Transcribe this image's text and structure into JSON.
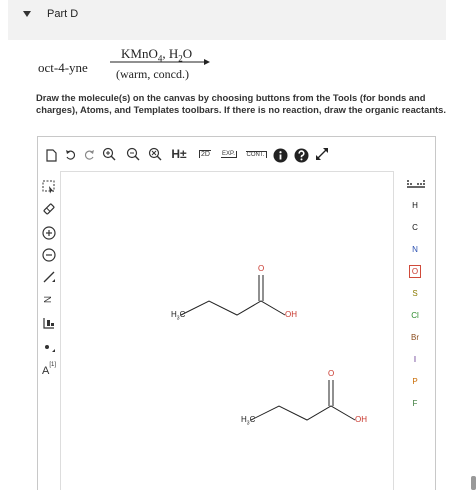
{
  "part": {
    "title": "Part D"
  },
  "reaction": {
    "reactant": "oct-4-yne",
    "reagent_main": "KMnO",
    "reagent_sub1": "4",
    "reagent_sep": ", H",
    "reagent_sub2": "2",
    "reagent_end": "O",
    "conditions": "(warm, concd.)"
  },
  "instructions": "Draw the molecule(s) on the canvas by choosing buttons from the Tools (for bonds and charges), Atoms, and Templates toolbars. If there is no reaction, draw the organic reactants.",
  "toolbar": {
    "h_label": "H±",
    "two_d_label": "2D",
    "exp_label": "EXP.",
    "cont_label": "CONT."
  },
  "left_tools": {
    "n_label": "N",
    "charge_label": "A",
    "charge_sup": "[1]"
  },
  "atoms": [
    "H",
    "C",
    "N",
    "O",
    "S",
    "Cl",
    "Br",
    "I",
    "P",
    "F"
  ],
  "molecules": [
    {
      "left_label": "H",
      "left_sub": "3",
      "left_end": "C",
      "carbonyl": "O",
      "hydroxyl": "OH"
    },
    {
      "left_label": "H",
      "left_sub": "3",
      "left_end": "C",
      "carbonyl": "O",
      "hydroxyl": "OH"
    }
  ],
  "colors": {
    "accent": "#c8362c",
    "nitrogen": "#2a4fb0"
  }
}
